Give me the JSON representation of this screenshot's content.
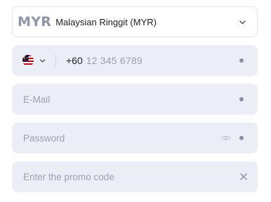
{
  "currency": {
    "code": "MYR",
    "name": "Malaysian Ringgit (MYR)",
    "chevron_icon": "chevron-down-icon"
  },
  "phone": {
    "flag_icon": "malaysia-flag-icon",
    "dial_code": "+60",
    "placeholder": "12 345 6789"
  },
  "email": {
    "placeholder": "E-Mail"
  },
  "password": {
    "placeholder": "Password",
    "toggle_icon": "eye-icon"
  },
  "promo": {
    "placeholder": "Enter the promo code",
    "clear_icon": "close-icon"
  },
  "colors": {
    "field_background": "#eceef7",
    "placeholder": "#9aa0b1",
    "text": "#1b1f2b",
    "currency_code": "#8e95a8"
  }
}
